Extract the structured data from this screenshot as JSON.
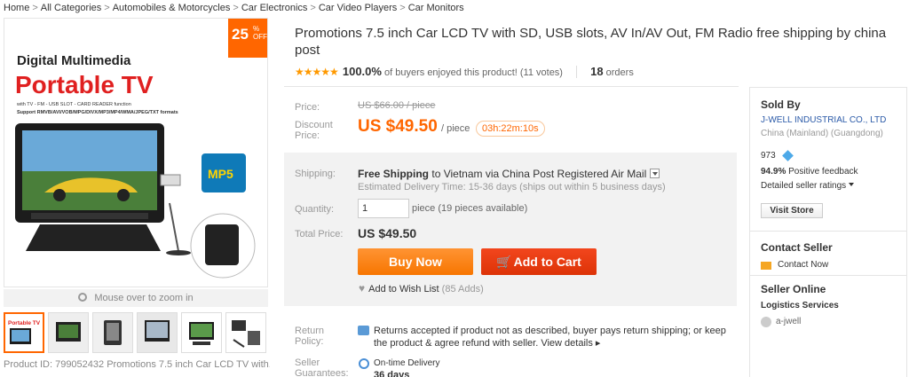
{
  "breadcrumb": [
    "Home",
    "All Categories",
    "Automobiles & Motorcycles",
    "Car Electronics",
    "Car Video Players",
    "Car Monitors"
  ],
  "gallery": {
    "discount_num": "25",
    "discount_pct": "%",
    "discount_off": "OFF",
    "box_title1": "Digital Multimedia",
    "box_title2": "Portable TV",
    "box_sub1": "with TV - FM - USB SLOT - CARD READER  function",
    "box_sub2": "Support RMVB/AVI/VOB/MPG/DIVX/MP3/MP4/WMA/JPEG/TXT formats",
    "mp5_label": "MP5",
    "zoom_hint": "Mouse over to zoom in",
    "thumb_text": "Portable TV",
    "product_id": "Product ID: 799052432 Promotions 7.5 inch Car LCD TV with..."
  },
  "product": {
    "title": "Promotions 7.5 inch Car LCD TV with SD, USB slots, AV In/AV Out, FM Radio free shipping by china post",
    "stars": "★★★★★",
    "rating_pct": "100.0%",
    "rating_text": "of buyers enjoyed this product! (11 votes)",
    "orders_count": "18",
    "orders_label": "orders"
  },
  "price": {
    "price_label": "Price:",
    "original_price": "US $66.00 / piece",
    "discount_label_1": "Discount",
    "discount_label_2": "Price:",
    "discount_price": "US $49.50",
    "per_piece": "/ piece",
    "timer": "03h:22m:10s"
  },
  "shipping": {
    "label": "Shipping:",
    "free": "Free Shipping",
    "to_text": "to  Vietnam via China Post Registered Air Mail",
    "delivery": "Estimated Delivery Time: 15-36 days (ships out within 5 business days)",
    "quantity_label": "Quantity:",
    "quantity_value": "1",
    "quantity_note": "piece (19 pieces available)",
    "total_label": "Total Price:",
    "total_value": "US $49.50",
    "buy_now": "Buy Now",
    "add_to_cart": "Add to Cart",
    "cart_glyph": "🛒",
    "wishlist": "Add to Wish List",
    "wishlist_count": "(85 Adds)"
  },
  "returns": {
    "label_1": "Return",
    "label_2": "Policy:",
    "text": "Returns accepted if product not as described, buyer pays return shipping; or keep the product & agree refund with seller.",
    "view_details": "View details ▸"
  },
  "guarantee": {
    "label_1": "Seller",
    "label_2": "Guarantees:",
    "ontime": "On-time Delivery",
    "days": "36 days"
  },
  "seller": {
    "sold_by": "Sold By",
    "name": "J-WELL INDUSTRIAL CO., LTD",
    "location": "China (Mainland) (Guangdong)",
    "score": "973",
    "feedback_pct": "94.9%",
    "feedback_label": "Positive feedback",
    "detailed_ratings": "Detailed seller ratings",
    "visit_store": "Visit Store",
    "contact_seller": "Contact Seller",
    "contact_now": "Contact Now",
    "seller_online": "Seller Online",
    "logistics": "Logistics Services",
    "member": "a-jwell"
  },
  "colors": {
    "accent_orange": "#ff6600",
    "cart_red": "#dd3307",
    "link_blue": "#2b5aa8"
  }
}
